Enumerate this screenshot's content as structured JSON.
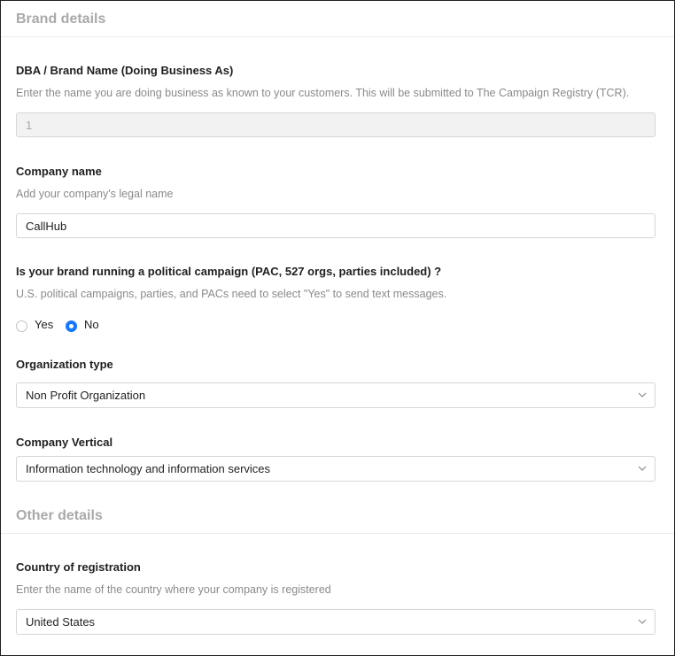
{
  "brand_section": {
    "title": "Brand details"
  },
  "dba": {
    "label": "DBA / Brand Name (Doing Business As)",
    "help": "Enter the name you are doing business as known to your customers. This will be submitted to The Campaign Registry (TCR).",
    "value": "1"
  },
  "company_name": {
    "label": "Company name",
    "help": "Add your company's legal name",
    "value": "CallHub"
  },
  "political": {
    "label": "Is your brand running a political campaign (PAC, 527 orgs, parties included) ?",
    "help": "U.S. political campaigns, parties, and PACs need to select \"Yes\" to send text messages.",
    "options": [
      {
        "label": "Yes",
        "checked": false
      },
      {
        "label": "No",
        "checked": true
      }
    ]
  },
  "organization_type": {
    "label": "Organization type",
    "selected": "Non Profit Organization"
  },
  "company_vertical": {
    "label": "Company Vertical",
    "selected": "Information technology and information services"
  },
  "other_section": {
    "title": "Other details"
  },
  "country": {
    "label": "Country of registration",
    "help": "Enter the name of the country where your company is registered",
    "selected": "United States"
  },
  "icons": {
    "dropdown": "chevron-down-icon",
    "radio": "radio-button"
  },
  "colors": {
    "accent": "#1677ff",
    "section_title": "#a9a9a9",
    "help_text": "#8a8a8a",
    "border": "#d6d6d6",
    "disabled_bg": "#f2f2f2"
  }
}
